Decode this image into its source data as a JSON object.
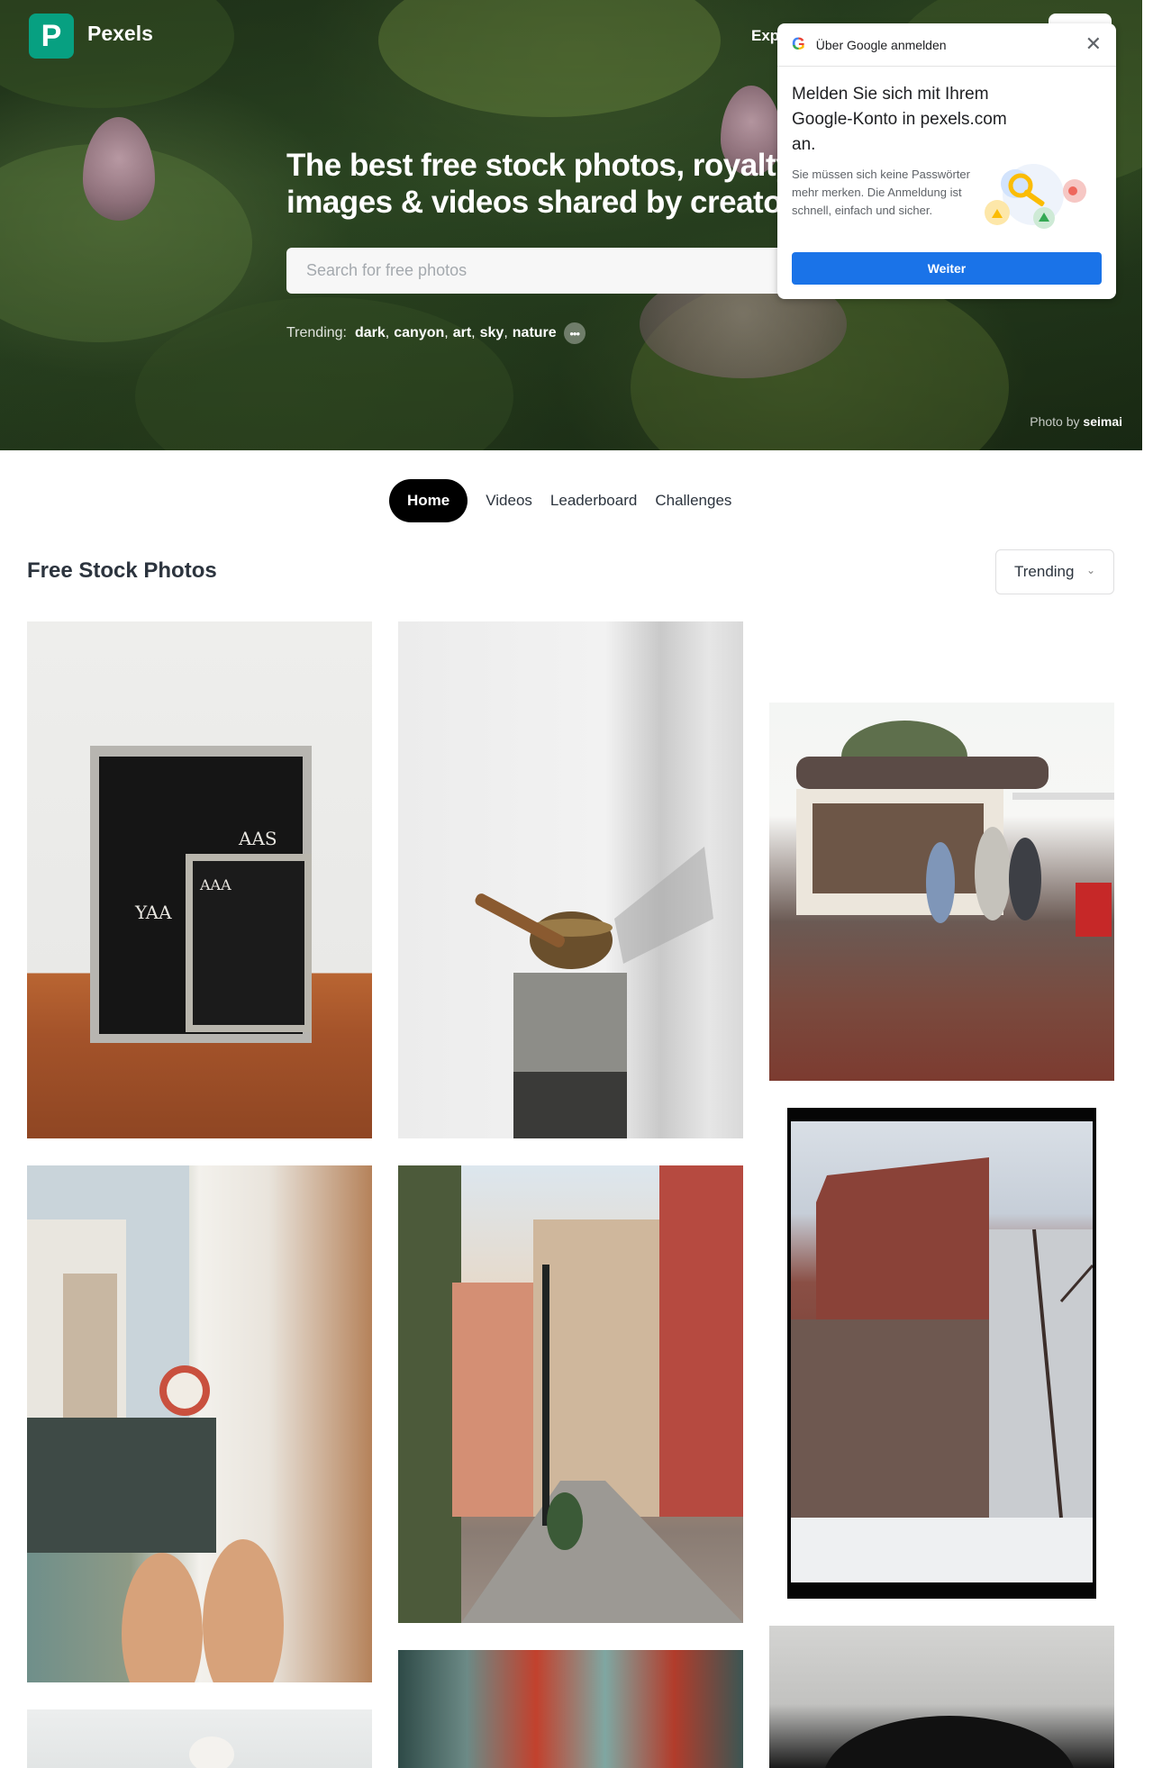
{
  "header": {
    "brand": "Pexels",
    "logo_letter": "P",
    "nav_explore": "Exp"
  },
  "hero": {
    "title_line1": "The best free stock photos, royalty f",
    "title_line2": "images & videos shared by creators.",
    "search_placeholder": "Search for free photos",
    "trending_label": "Trending:",
    "trending_tags": [
      "dark",
      "canyon",
      "art",
      "sky",
      "nature"
    ],
    "credit_prefix": "Photo by",
    "credit_author": "seimai"
  },
  "google_popup": {
    "title": "Über Google anmelden",
    "main_text": "Melden Sie sich mit Ihrem Google-Konto in pexels.com an.",
    "sub_text": "Sie müssen sich keine Passwörter mehr merken. Die Anmeldung ist schnell, einfach und sicher.",
    "button_label": "Weiter"
  },
  "tabs": [
    {
      "label": "Home",
      "active": true
    },
    {
      "label": "Videos",
      "active": false
    },
    {
      "label": "Leaderboard",
      "active": false
    },
    {
      "label": "Challenges",
      "active": false
    }
  ],
  "gallery": {
    "title": "Free Stock Photos",
    "sort_label": "Trending",
    "letterboard_text_1": "YAA",
    "letterboard_text_2": "AAS",
    "letterboard_text_3": "AAA"
  },
  "colors": {
    "brand": "#07a081",
    "google_button": "#1a73e8"
  }
}
